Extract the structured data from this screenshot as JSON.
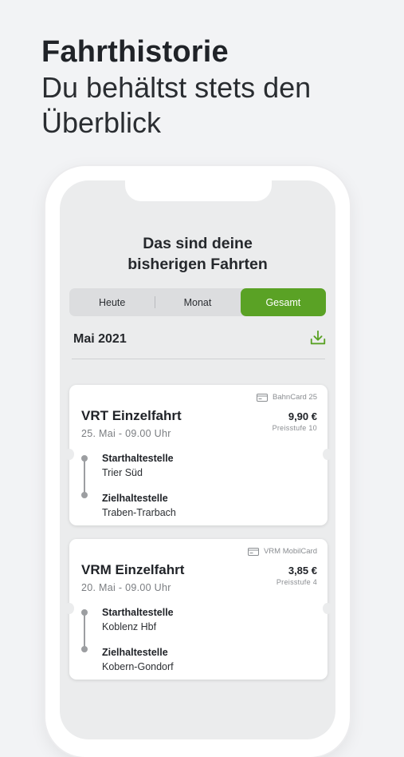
{
  "headline": {
    "title": "Fahrthistorie",
    "subtitle_line1": "Du behältst stets den",
    "subtitle_line2": "Überblick"
  },
  "screen": {
    "title_line1": "Das sind deine",
    "title_line2": "bisherigen Fahrten",
    "tabs": [
      {
        "label": "Heute",
        "active": false
      },
      {
        "label": "Monat",
        "active": false
      },
      {
        "label": "Gesamt",
        "active": true
      }
    ],
    "month": "Mai 2021",
    "download_icon": "download-icon",
    "accent_color": "#5aa225"
  },
  "rides": [
    {
      "tag": "BahnCard 25",
      "tag_icon": "card-icon",
      "name": "VRT Einzelfahrt",
      "date": "25. Mai - 09.00 Uhr",
      "price": "9,90 €",
      "price_level": "Preisstufe 10",
      "start_label": "Starthaltestelle",
      "start": "Trier Süd",
      "end_label": "Zielhaltestelle",
      "end": "Traben-Trarbach"
    },
    {
      "tag": "VRM MobilCard",
      "tag_icon": "card-icon",
      "name": "VRM Einzelfahrt",
      "date": "20. Mai - 09.00 Uhr",
      "price": "3,85 €",
      "price_level": "Preisstufe 4",
      "start_label": "Starthaltestelle",
      "start": "Koblenz Hbf",
      "end_label": "Zielhaltestelle",
      "end": "Kobern-Gondorf"
    }
  ]
}
